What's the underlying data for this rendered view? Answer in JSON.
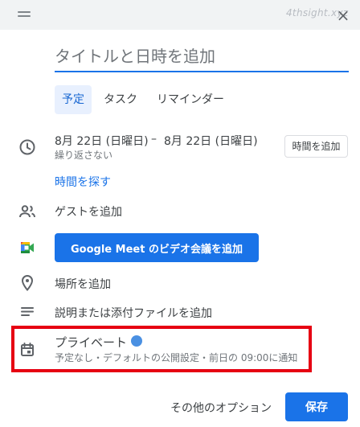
{
  "watermark": "4thsight.xyz",
  "close_glyph": "×",
  "title": {
    "placeholder": "タイトルと日時を追加",
    "value": ""
  },
  "tabs": [
    {
      "label": "予定",
      "active": true
    },
    {
      "label": "タスク",
      "active": false
    },
    {
      "label": "リマインダー",
      "active": false
    }
  ],
  "datetime": {
    "start": "8月 22日 (日曜日)",
    "separator": "–",
    "end": "8月 22日 (日曜日)",
    "repeat": "繰り返さない",
    "add_time_button": "時間を追加",
    "find_time_link": "時間を探す"
  },
  "guests": {
    "label": "ゲストを追加"
  },
  "meet": {
    "button_label": "Google Meet のビデオ会議を追加"
  },
  "location": {
    "label": "場所を追加"
  },
  "description": {
    "label": "説明または添付ファイルを追加"
  },
  "calendar": {
    "name": "プライベート",
    "color": "#4a90e2",
    "details": "予定なし・デフォルトの公開設定・前日の 09:00に通知"
  },
  "footer": {
    "more_options": "その他のオプション",
    "save": "保存"
  },
  "colors": {
    "accent": "#1a73e8",
    "highlight_border": "#e60012"
  }
}
